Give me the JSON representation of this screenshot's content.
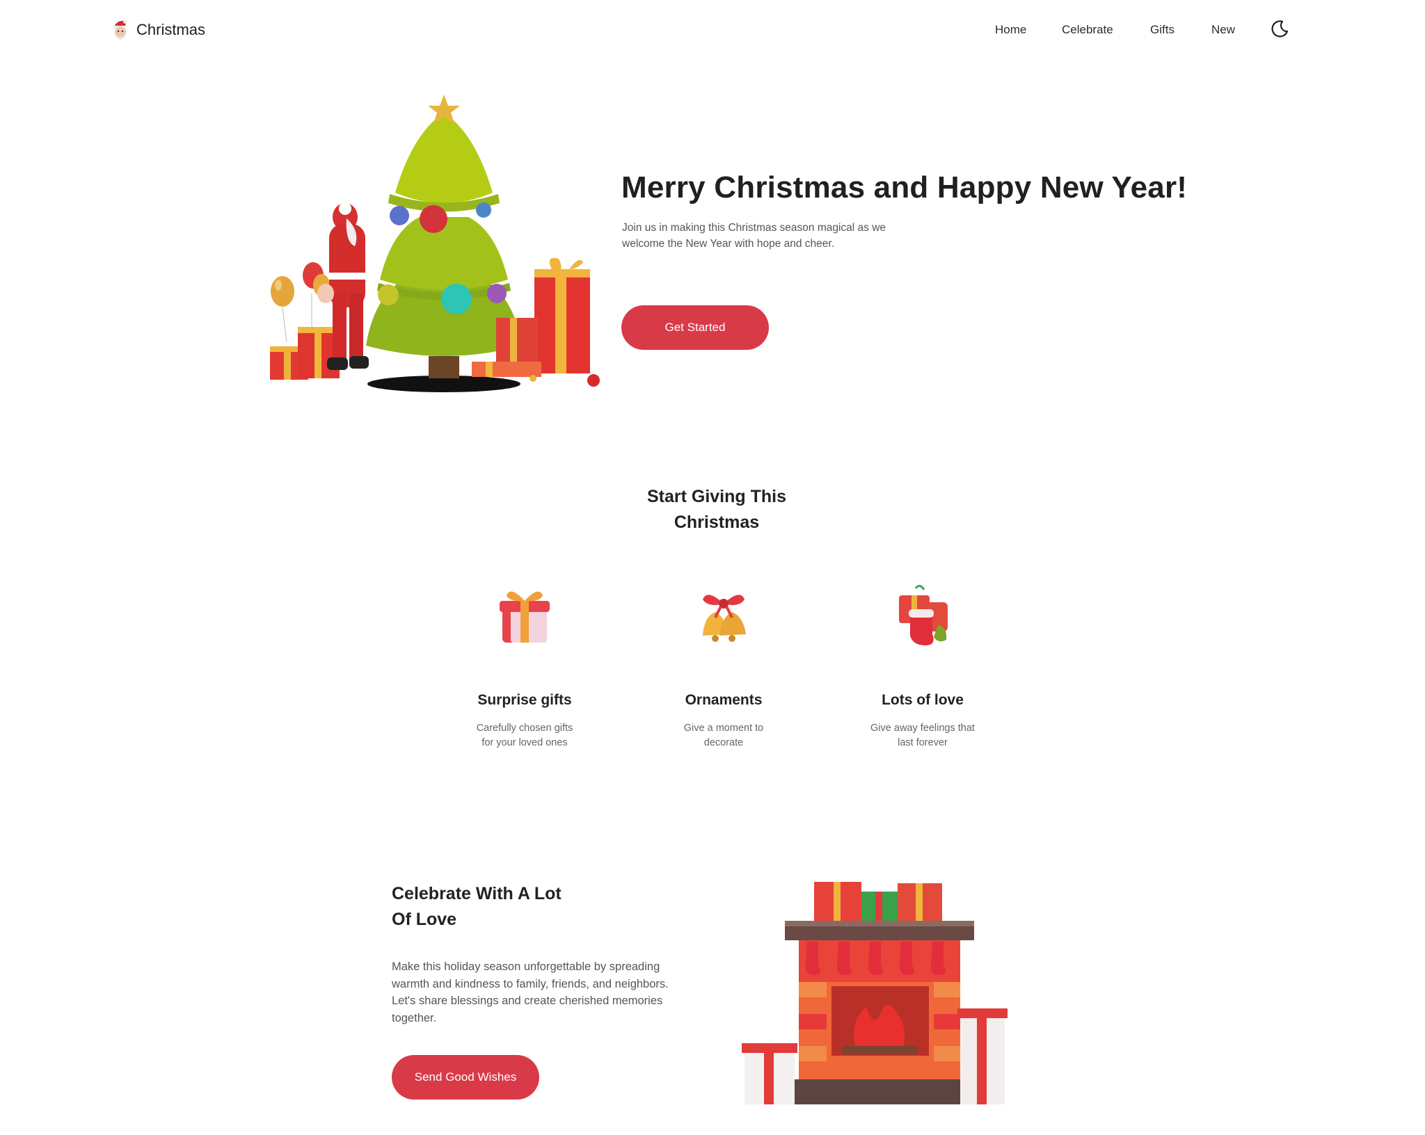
{
  "header": {
    "logo_text": "Christmas",
    "nav": [
      {
        "label": "Home"
      },
      {
        "label": "Celebrate"
      },
      {
        "label": "Gifts"
      },
      {
        "label": "New"
      }
    ],
    "theme_toggle_icon": "moon-icon"
  },
  "hero": {
    "title": "Merry Christmas and Happy New Year!",
    "description": "Join us in making this Christmas season magical as we welcome the New Year with hope and cheer.",
    "button_label": "Get Started"
  },
  "giving": {
    "title": "Start Giving This Christmas",
    "cards": [
      {
        "icon": "gift-box-icon",
        "title": "Surprise gifts",
        "description": "Carefully chosen gifts for your loved ones"
      },
      {
        "icon": "bells-icon",
        "title": "Ornaments",
        "description": "Give a moment to decorate"
      },
      {
        "icon": "stocking-icon",
        "title": "Lots of love",
        "description": "Give away feelings that last forever"
      }
    ]
  },
  "celebrate": {
    "title": "Celebrate With A Lot Of Love",
    "description": "Make this holiday season unforgettable by spreading warmth and kindness to family, friends, and neighbors. Let's share blessings and create cherished memories together.",
    "button_label": "Send Good Wishes"
  },
  "colors": {
    "accent": "#d93a48",
    "text": "#1f1f1f",
    "muted": "#555555"
  }
}
